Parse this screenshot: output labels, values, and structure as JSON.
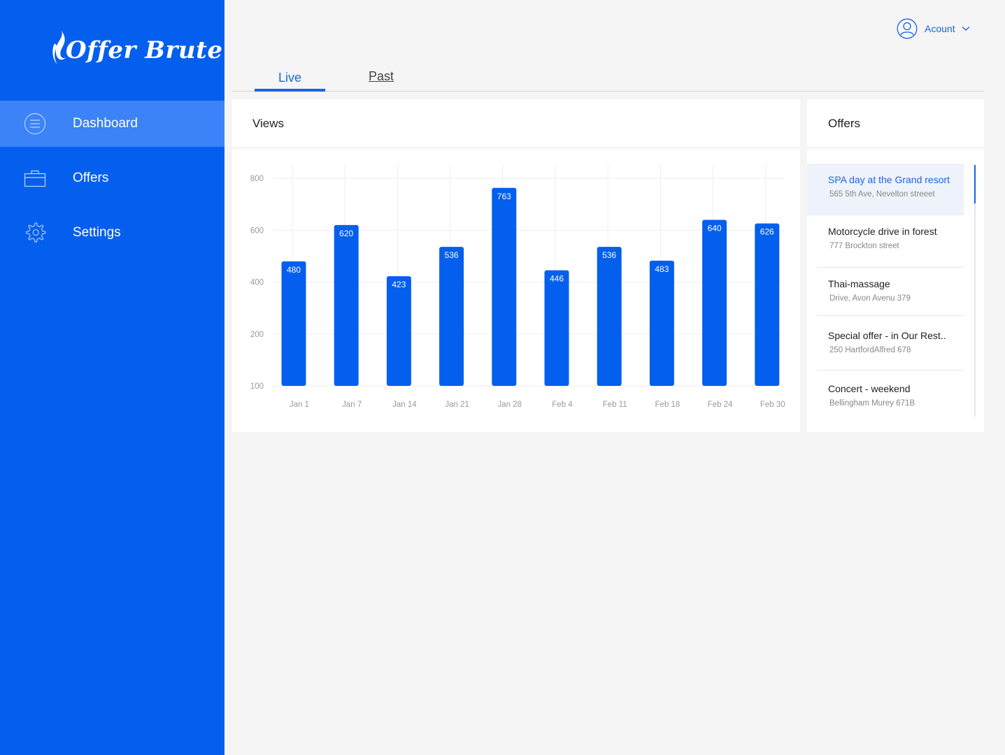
{
  "brand": {
    "name": "Offer Brute"
  },
  "sidebar": {
    "items": [
      {
        "label": "Dashboard",
        "icon": "menu-circle-icon",
        "active": true
      },
      {
        "label": "Offers",
        "icon": "briefcase-icon",
        "active": false
      },
      {
        "label": "Settings",
        "icon": "gear-icon",
        "active": false
      }
    ]
  },
  "header": {
    "account_label": "Acount"
  },
  "tabs": [
    {
      "label": "Live",
      "active": true
    },
    {
      "label": "Past",
      "active": false
    }
  ],
  "views": {
    "title": "Views"
  },
  "offers_panel": {
    "title": "Offers",
    "items": [
      {
        "title": "SPA day at the Grand resort",
        "address": "565 5th Ave, Nevelton streeet",
        "active": true
      },
      {
        "title": "Motorcycle drive in forest",
        "address": "777 Brockton street",
        "active": false
      },
      {
        "title": "Thai-massage",
        "address": "Drive, Avon Avenu 379",
        "active": false
      },
      {
        "title": "Special offer - in Our Rest..",
        "address": "250 HartfordAlfred 678",
        "active": false
      },
      {
        "title": "Concert - weekend",
        "address": "Bellingham Murey 671B",
        "active": false
      }
    ]
  },
  "colors": {
    "primary": "#055fee",
    "accent": "#1a64e8",
    "sidebar_active": "#3b83f6",
    "bar": "#055fee"
  },
  "chart_data": {
    "type": "bar",
    "categories": [
      "Jan 1",
      "Jan 7",
      "Jan 14",
      "Jan 21",
      "Jan 28",
      "Feb 4",
      "Feb 11",
      "Feb 18",
      "Feb 24",
      "Feb 30"
    ],
    "values": [
      480,
      620,
      423,
      536,
      763,
      446,
      536,
      483,
      640,
      626
    ],
    "yticks": [
      "800",
      "600",
      "400",
      "200",
      "100"
    ],
    "grid": true
  }
}
